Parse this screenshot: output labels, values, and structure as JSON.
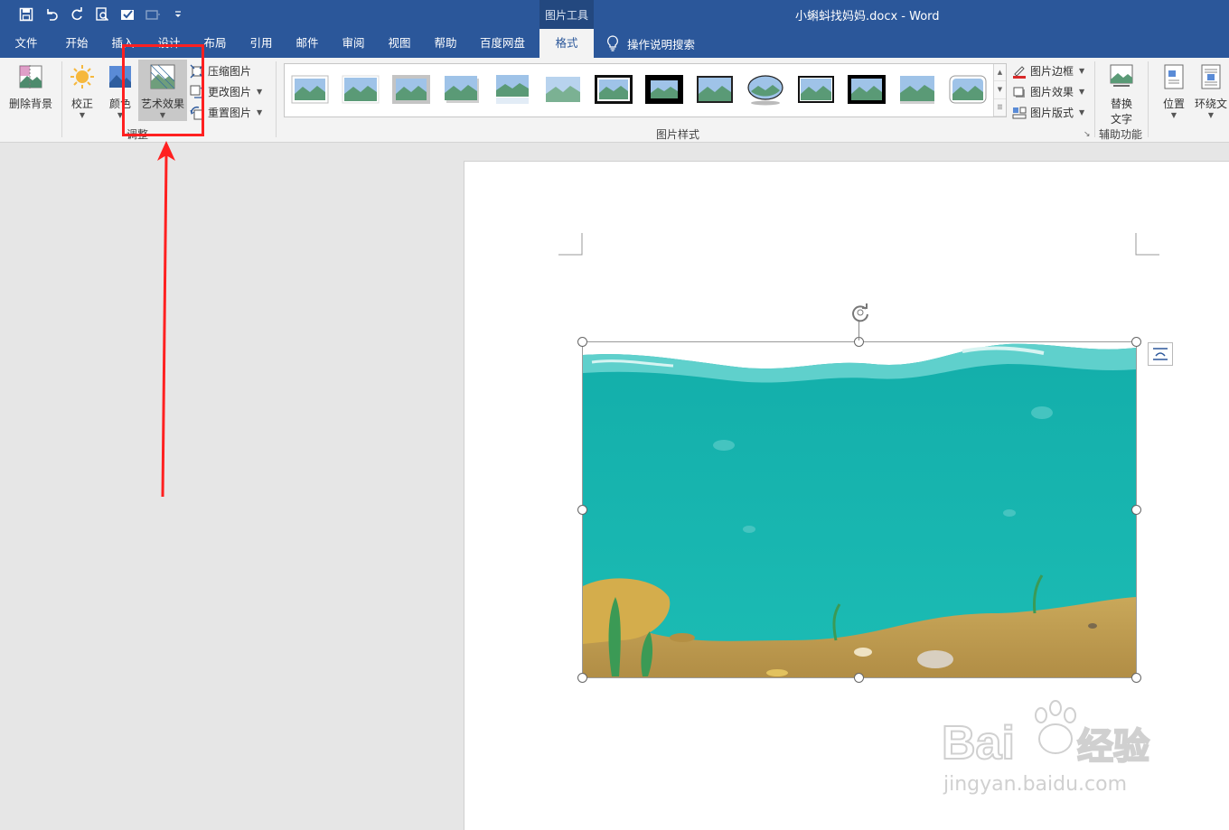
{
  "window": {
    "context_group": "图片工具",
    "doc_title": "小蝌蚪找妈妈.docx  -  Word"
  },
  "tabs": [
    "文件",
    "开始",
    "插入",
    "设计",
    "布局",
    "引用",
    "邮件",
    "审阅",
    "视图",
    "帮助",
    "百度网盘",
    "格式"
  ],
  "active_tab": "格式",
  "search_hint": "操作说明搜索",
  "ribbon": {
    "remove_bg": "删除背景",
    "corrections": "校正",
    "color": "颜色",
    "artistic_effects": "艺术效果",
    "compress": "压缩图片",
    "change_picture": "更改图片",
    "reset_picture": "重置图片",
    "adjust_group": "调整",
    "styles_group": "图片样式",
    "picture_border": "图片边框",
    "picture_effects": "图片效果",
    "picture_layout": "图片版式",
    "alt_text_line1": "替换",
    "alt_text_line2": "文字",
    "accessibility_group": "辅助功能",
    "position": "位置",
    "wrap_text": "环绕文"
  },
  "watermark": {
    "brand": "Bai du 经验",
    "url": "jingyan.baidu.com"
  },
  "colors": {
    "word_blue": "#2b579a",
    "annotation_red": "#ff2020",
    "water": "#17b5b0",
    "sand": "#c9a85a"
  }
}
